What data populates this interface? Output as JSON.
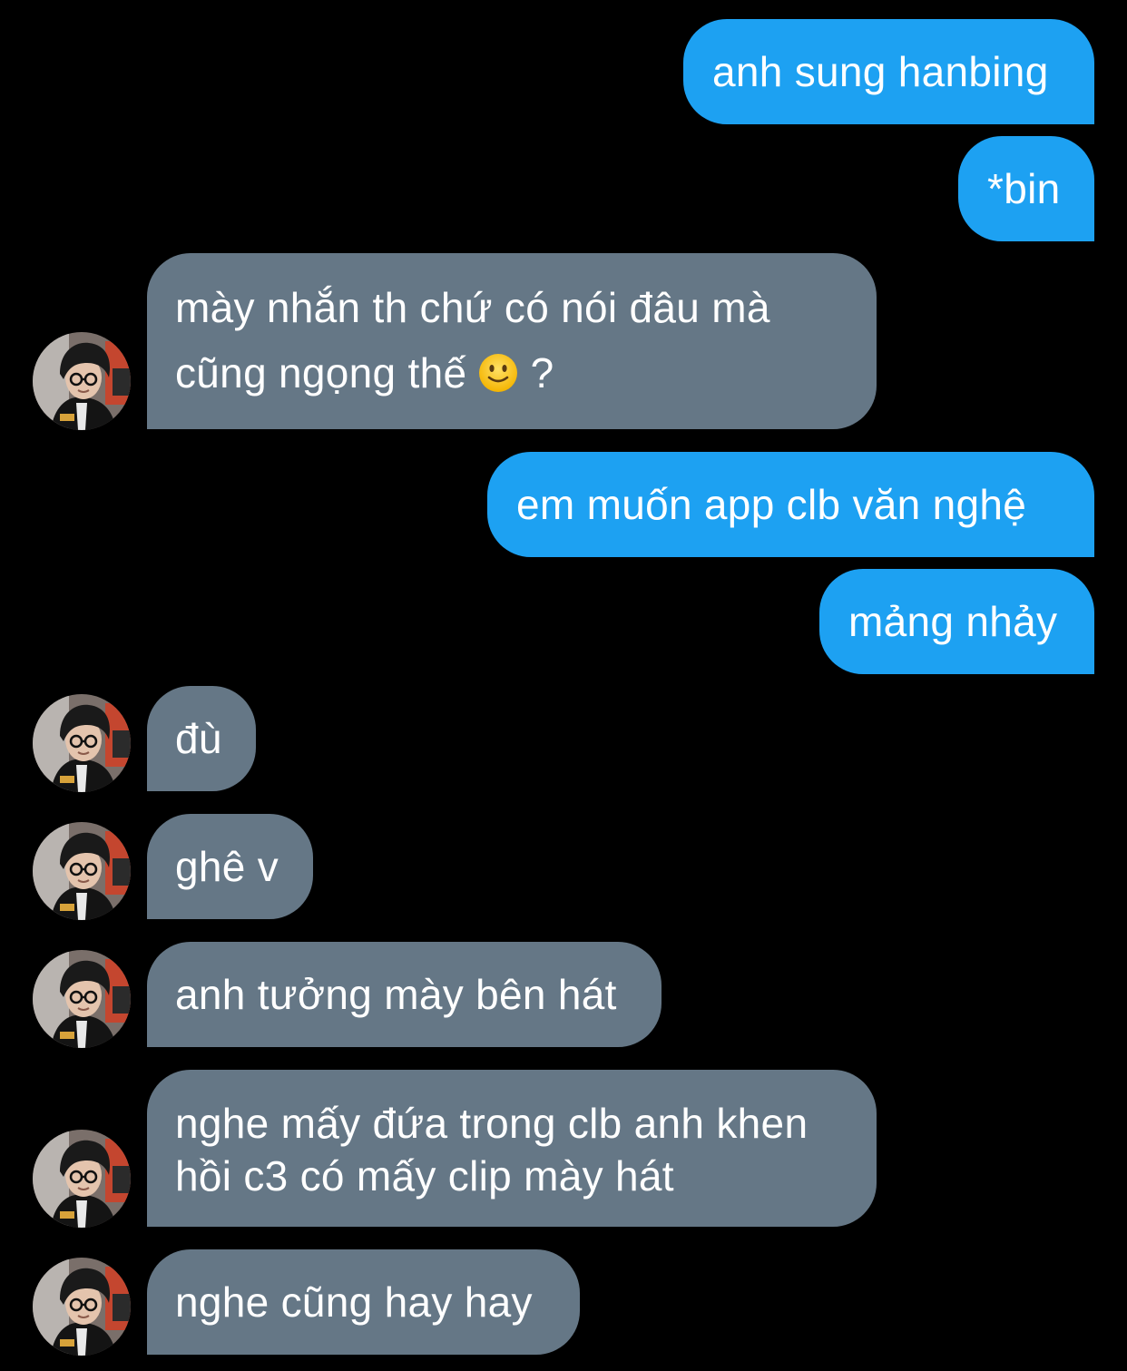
{
  "conversation": {
    "messages": [
      {
        "side": "sent",
        "lines": [
          "anh sung hanbing"
        ]
      },
      {
        "side": "sent",
        "lines": [
          "*bin"
        ]
      },
      {
        "side": "received",
        "lines": [
          "mày nhắn th chứ có nói đâu mà",
          "cũng ngọng thế",
          "?"
        ],
        "emoji": "slightly-smiling-face-icon"
      },
      {
        "side": "sent",
        "lines": [
          "em muốn app clb văn nghệ"
        ]
      },
      {
        "side": "sent",
        "lines": [
          "mảng nhảy"
        ]
      },
      {
        "side": "received",
        "lines": [
          "đù"
        ]
      },
      {
        "side": "received",
        "lines": [
          "ghê v"
        ]
      },
      {
        "side": "received",
        "lines": [
          "anh tưởng mày bên hát"
        ]
      },
      {
        "side": "received",
        "lines": [
          "nghe mấy đứa trong clb anh khen",
          "hồi c3 có mấy clip mày hát"
        ]
      },
      {
        "side": "received",
        "lines": [
          "nghe cũng hay hay"
        ]
      }
    ]
  },
  "colors": {
    "background": "#000000",
    "sent_bubble": "#1da1f2",
    "received_bubble": "#657786",
    "text": "#ffffff"
  }
}
